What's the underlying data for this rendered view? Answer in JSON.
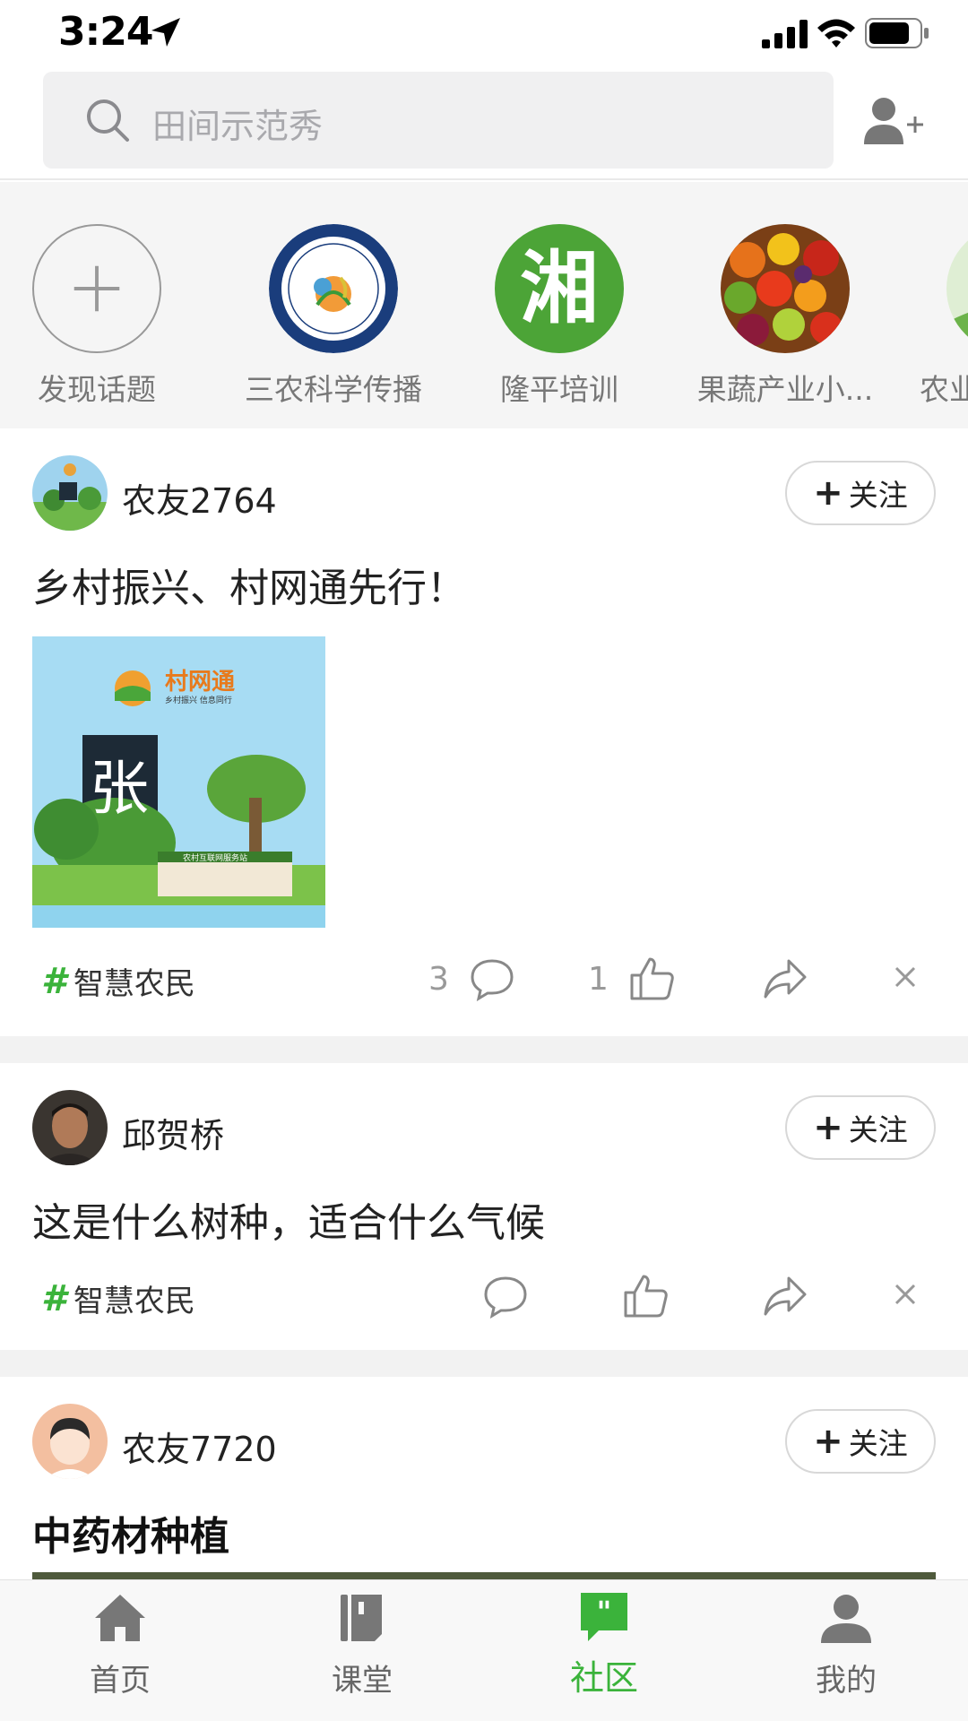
{
  "status": {
    "time": "3:24"
  },
  "search": {
    "placeholder": "田间示范秀"
  },
  "topics": [
    {
      "label": "发现话题"
    },
    {
      "label": "三农科学传播"
    },
    {
      "label": "隆平培训",
      "glyph": "湘"
    },
    {
      "label": "果蔬产业小..."
    },
    {
      "label": "农业"
    }
  ],
  "posts": [
    {
      "user": "农友2764",
      "follow": "关注",
      "text": "乡村振兴、村网通先行！",
      "image_text": {
        "brand": "村网通",
        "slogan": "乡村振兴 信息同行",
        "char": "张",
        "sign": "农村互联网服务站"
      },
      "tag": "智慧农民",
      "comments": "3",
      "likes": "1"
    },
    {
      "user": "邱贺桥",
      "follow": "关注",
      "text": "这是什么树种，适合什么气候",
      "tag": "智慧农民"
    },
    {
      "user": "农友7720",
      "follow": "关注",
      "title": "中药材种植"
    }
  ],
  "tabs": [
    {
      "label": "首页",
      "icon": "home-icon"
    },
    {
      "label": "课堂",
      "icon": "book-icon"
    },
    {
      "label": "社区",
      "icon": "community-chat-icon",
      "active": true
    },
    {
      "label": "我的",
      "icon": "profile-icon"
    }
  ],
  "colors": {
    "accent": "#3bb33b",
    "muted": "#999999"
  }
}
